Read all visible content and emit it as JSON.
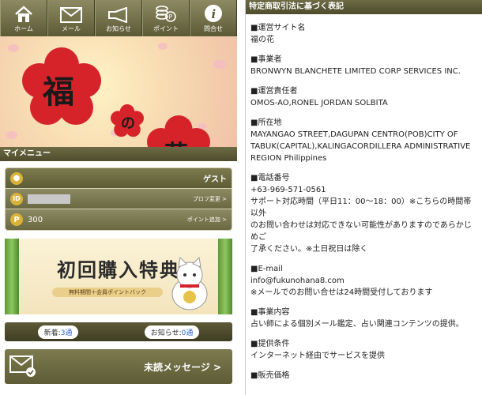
{
  "nav": [
    {
      "label": "ホーム",
      "icon": "home-icon"
    },
    {
      "label": "メール",
      "icon": "mail-icon"
    },
    {
      "label": "お知らせ",
      "icon": "megaphone-icon"
    },
    {
      "label": "ポイント",
      "icon": "coins-icon"
    },
    {
      "label": "問合せ",
      "icon": "info-icon"
    }
  ],
  "banner": {
    "char1": "福",
    "char2": "の",
    "char3": "花"
  },
  "mymenu": {
    "title": "マイメニュー",
    "guest_label": "ゲスト",
    "profile_link": "プロフ変更 >",
    "points": "300",
    "points_link": "ポイント追加 >"
  },
  "promo": {
    "title": "初回購入特典",
    "subtitle": "無料期間＋会員ポイントバック"
  },
  "counts": {
    "new_label": "新着:",
    "new_value": "3通",
    "notice_label": "お知らせ:",
    "notice_value": "0通"
  },
  "message": {
    "label": "未読メッセージ >"
  },
  "legal": {
    "title": "特定商取引法に基づく表記",
    "items": [
      {
        "label": "■運営サイト名",
        "value": "福の花"
      },
      {
        "label": "■事業者",
        "value": "BRONWYN BLANCHETE LIMITED CORP SERVICES INC."
      },
      {
        "label": "■運営責任者",
        "value": "OMOS-AO,RONEL JORDAN SOLBITA"
      },
      {
        "label": "■所在地",
        "value": "MAYANGAO STREET,DAGUPAN CENTRO(POB)CITY OF\nTABUK(CAPITAL),KALINGACORDILLERA ADMINISTRATIVE\nREGION Philippines"
      },
      {
        "label": "■電話番号",
        "value": "+63-969-571-0561\nサポート対応時間（平日11：00〜18：00）※こちらの時間帯以外\nのお問い合わせは対応できない可能性がありますのであらかじめご\n了承ください。※土日祝日は除く"
      },
      {
        "label": "■E-mail",
        "value": "info@fukunohana8.com\n※メールでのお問い合せは24時間受付しております"
      },
      {
        "label": "■事業内容",
        "value": "占い師による個別メール鑑定、占い関連コンテンツの提供。"
      },
      {
        "label": "■提供条件",
        "value": "インターネット経由でサービスを提供"
      },
      {
        "label": "■販売価格",
        "value": ""
      }
    ]
  }
}
